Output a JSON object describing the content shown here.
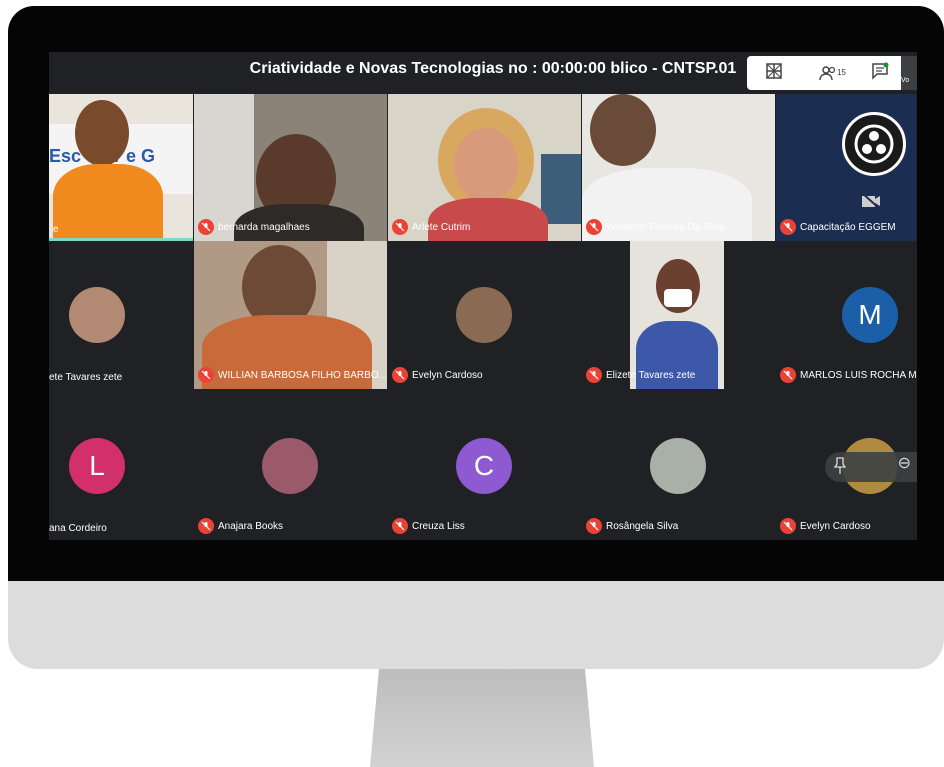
{
  "meeting": {
    "title": "Criatividade e Novas Tecnologias no : 00:00:00 blico - CNTSP.01",
    "participant_count": "15",
    "accent": "#7fd6c9",
    "muted_color": "#ea4335"
  },
  "controls": {
    "grid_icon": "grid-view-icon",
    "people_icon": "people-icon",
    "chat_icon": "chat-icon",
    "corner_label": "Vo"
  },
  "tiles": [
    {
      "name": "e",
      "muted": false
    },
    {
      "name": "bernarda magalhaes",
      "muted": true
    },
    {
      "name": "Arlete Cutrim",
      "muted": true
    },
    {
      "name": "Werberth Ferreira Da Silva",
      "muted": true
    },
    {
      "name": "Capacitação EGGEM",
      "muted": true
    },
    {
      "name": "ete Tavares zete",
      "muted": false
    },
    {
      "name": "WILLIAN BARBOSA FILHO BARBO...",
      "muted": true
    },
    {
      "name": "Evelyn Cardoso",
      "muted": true
    },
    {
      "name": "Elizete Tavares zete",
      "muted": true
    },
    {
      "name": "MARLOS LUIS ROCHA MA",
      "muted": true,
      "initial": "M",
      "color": "#1a5fa8"
    },
    {
      "name": "ana Cordeiro",
      "muted": false,
      "initial": "L",
      "color": "#d32f6b"
    },
    {
      "name": "Anajara Books",
      "muted": true
    },
    {
      "name": "Creuza Liss",
      "muted": true,
      "initial": "C",
      "color": "#8e5ad1"
    },
    {
      "name": "Rosângela Silva",
      "muted": true
    },
    {
      "name": "Evelyn Cardoso",
      "muted": true
    }
  ],
  "backdrop": {
    "banner_text": "Esc Gov e G"
  }
}
